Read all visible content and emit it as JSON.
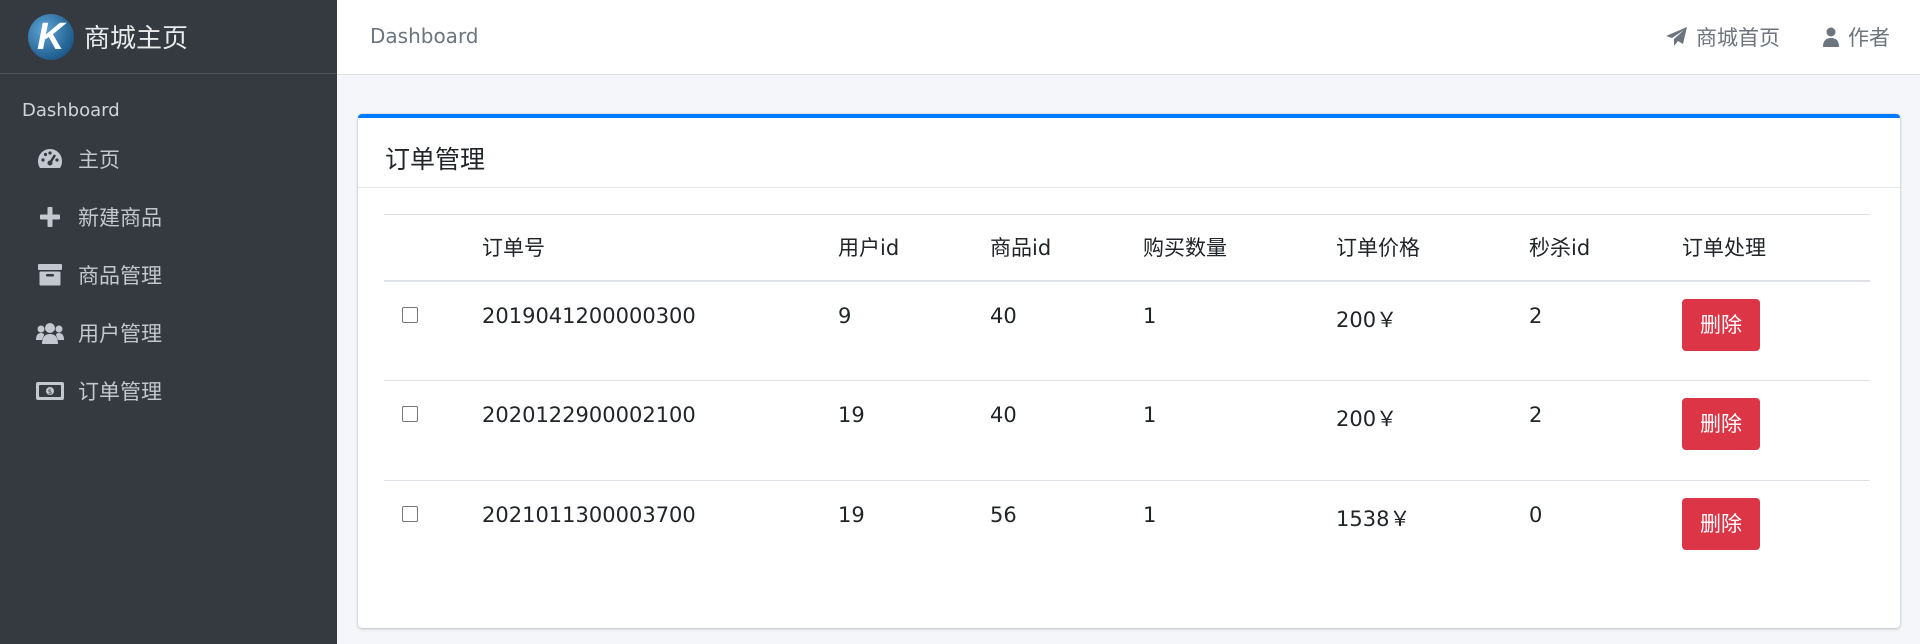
{
  "sidebar": {
    "brand": "商城主页",
    "brand_logo_letter": "K",
    "section_header": "Dashboard",
    "items": [
      {
        "label": "主页",
        "icon": "tachometer-icon"
      },
      {
        "label": "新建商品",
        "icon": "plus-icon"
      },
      {
        "label": "商品管理",
        "icon": "archive-icon"
      },
      {
        "label": "用户管理",
        "icon": "users-icon"
      },
      {
        "label": "订单管理",
        "icon": "money-bill-icon"
      }
    ]
  },
  "topbar": {
    "breadcrumb": "Dashboard",
    "home_link": "商城首页",
    "author_link": "作者"
  },
  "card": {
    "title": "订单管理",
    "accent_color": "#007bff"
  },
  "table": {
    "headers": [
      "订单号",
      "用户id",
      "商品id",
      "购买数量",
      "订单价格",
      "秒杀id",
      "订单处理"
    ],
    "rows": [
      {
        "order_no": "2019041200000300",
        "user_id": "9",
        "goods_id": "40",
        "qty": "1",
        "price": "200￥",
        "kill_id": "2",
        "action": "删除"
      },
      {
        "order_no": "2020122900002100",
        "user_id": "19",
        "goods_id": "40",
        "qty": "1",
        "price": "200￥",
        "kill_id": "2",
        "action": "删除"
      },
      {
        "order_no": "2021011300003700",
        "user_id": "19",
        "goods_id": "56",
        "qty": "1",
        "price": "1538￥",
        "kill_id": "0",
        "action": "删除"
      }
    ]
  },
  "colors": {
    "sidebar_bg": "#343a40",
    "delete_button": "#dc3545"
  }
}
